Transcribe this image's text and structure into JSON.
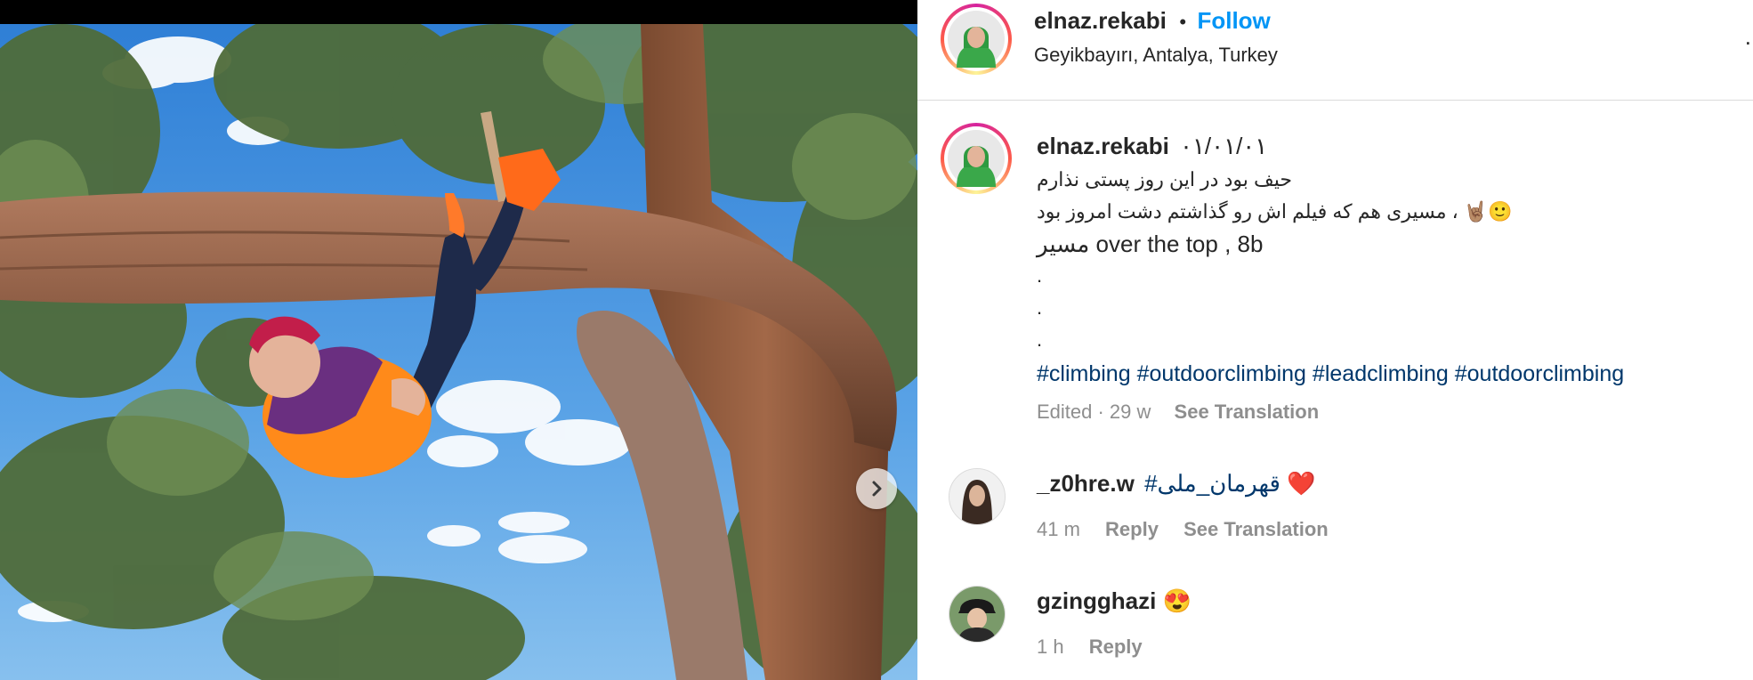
{
  "post": {
    "header": {
      "username": "elnaz.rekabi",
      "separator": "•",
      "follow_label": "Follow",
      "location": "Geyikbayırı, Antalya, Turkey",
      "more_glyph": "."
    },
    "caption": {
      "username": "elnaz.rekabi",
      "date": "۰۱/۰۱/۰۱",
      "lines": [
        "حیف بود در این روز پستی نذارم",
        "مسیری هم که فیلم اش رو گذاشتم دشت امروز بود ، 🤘🏽🙂",
        "مسیر over the top , 8b",
        ".",
        ".",
        "."
      ],
      "hashtags": [
        "#climbing",
        "#outdoorclimbing",
        "#leadclimbing",
        "#outdoorclimbing"
      ],
      "meta_time": "Edited · 29 w",
      "see_translation": "See Translation"
    },
    "comments": [
      {
        "username": "_z0hre.w",
        "text": "#قهرمان_ملی",
        "emoji": "❤️",
        "time": "41 m",
        "reply_label": "Reply",
        "see_translation": "See Translation"
      },
      {
        "username": "gzingghazi",
        "text": "",
        "emoji": "😍",
        "time": "1 h",
        "reply_label": "Reply"
      }
    ]
  },
  "icons": {
    "next": "chevron-right-icon"
  },
  "colors": {
    "follow": "#0095f6",
    "hashtag": "#00376b",
    "meta": "#8e8e8e",
    "text": "#262626"
  }
}
